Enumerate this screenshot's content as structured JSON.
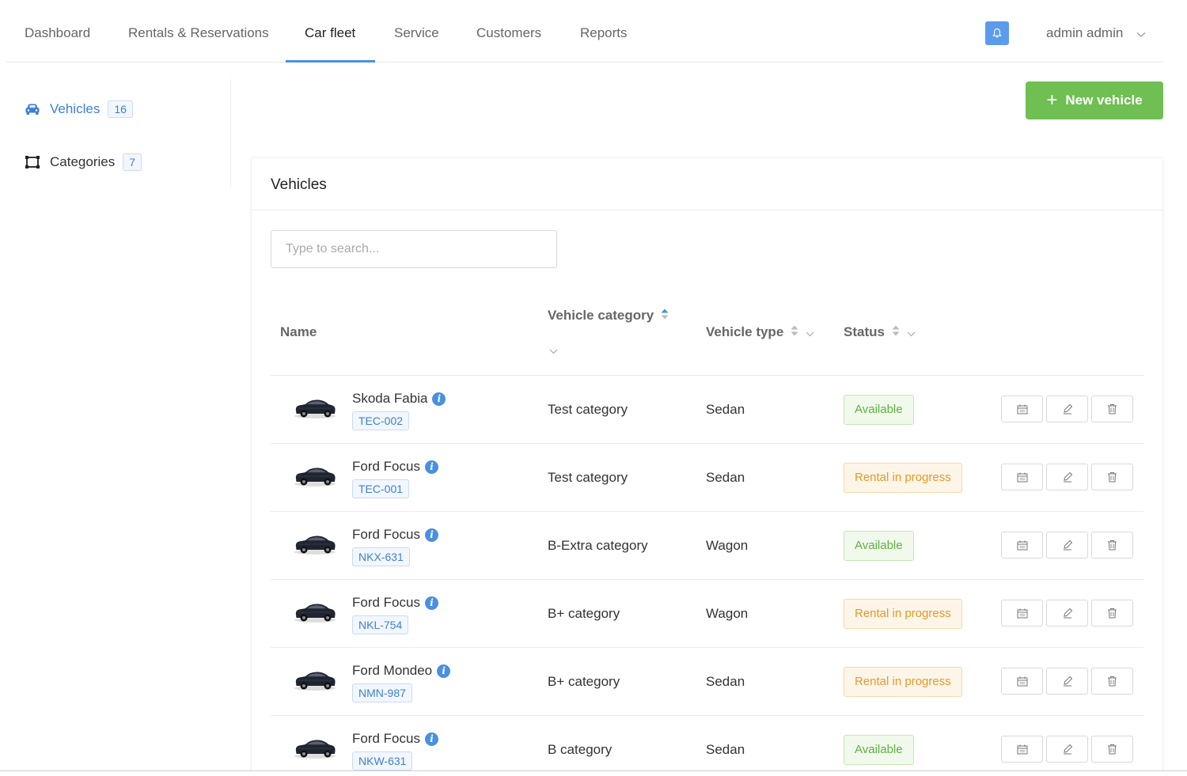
{
  "nav": {
    "items": [
      {
        "label": "Dashboard",
        "active": false
      },
      {
        "label": "Rentals & Reservations",
        "active": false
      },
      {
        "label": "Car fleet",
        "active": true
      },
      {
        "label": "Service",
        "active": false
      },
      {
        "label": "Customers",
        "active": false
      },
      {
        "label": "Reports",
        "active": false
      }
    ],
    "user": "admin admin"
  },
  "sidebar": {
    "items": [
      {
        "label": "Vehicles",
        "count": "16",
        "icon": "car-icon",
        "active": true
      },
      {
        "label": "Categories",
        "count": "7",
        "icon": "categories-icon",
        "active": false
      }
    ]
  },
  "actions": {
    "new_vehicle": "New vehicle"
  },
  "panel": {
    "title": "Vehicles",
    "search_placeholder": "Type to search...",
    "columns": {
      "name": "Name",
      "category": "Vehicle category",
      "type": "Vehicle type",
      "status": "Status"
    },
    "rows": [
      {
        "name": "Skoda Fabia",
        "plate": "TEC-002",
        "category": "Test category",
        "type": "Sedan",
        "status": "Available",
        "status_kind": "available"
      },
      {
        "name": "Ford Focus",
        "plate": "TEC-001",
        "category": "Test category",
        "type": "Sedan",
        "status": "Rental in progress",
        "status_kind": "progress"
      },
      {
        "name": "Ford Focus",
        "plate": "NKX-631",
        "category": "B-Extra category",
        "type": "Wagon",
        "status": "Available",
        "status_kind": "available"
      },
      {
        "name": "Ford Focus",
        "plate": "NKL-754",
        "category": "B+ category",
        "type": "Wagon",
        "status": "Rental in progress",
        "status_kind": "progress"
      },
      {
        "name": "Ford Mondeo",
        "plate": "NMN-987",
        "category": "B+ category",
        "type": "Sedan",
        "status": "Rental in progress",
        "status_kind": "progress"
      },
      {
        "name": "Ford Focus",
        "plate": "NKW-631",
        "category": "B category",
        "type": "Sedan",
        "status": "Available",
        "status_kind": "available"
      }
    ]
  },
  "colors": {
    "accent": "#4a8fe0",
    "success": "#6fbf52",
    "available_text": "#5fb040",
    "progress_text": "#e49a2a"
  }
}
